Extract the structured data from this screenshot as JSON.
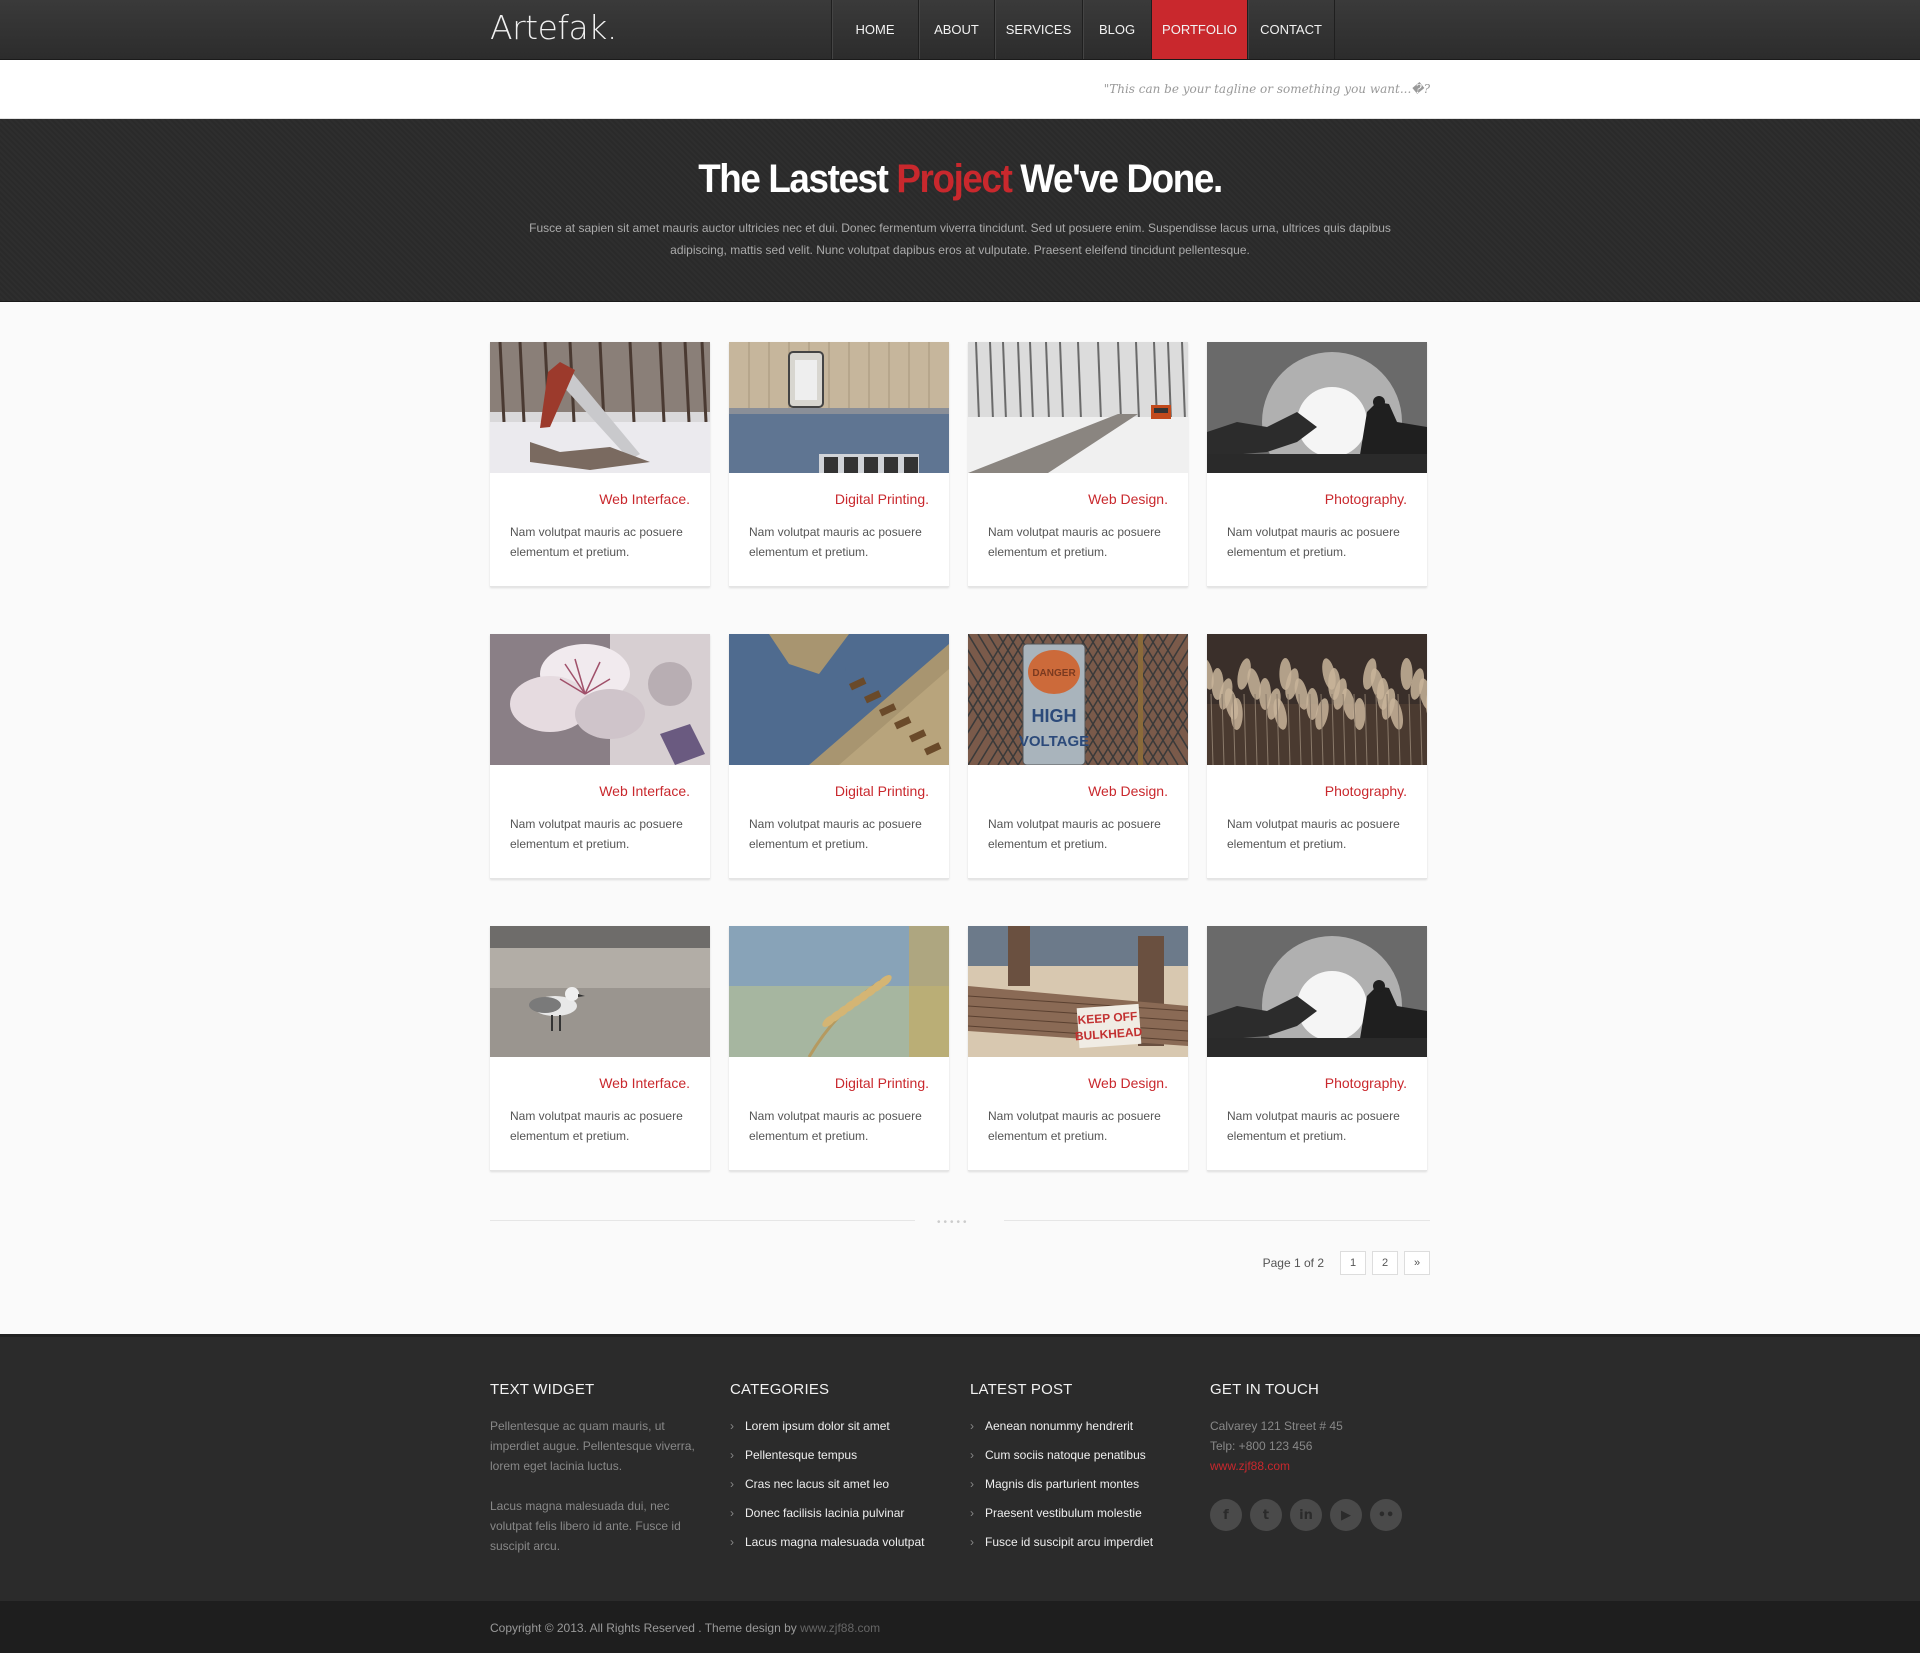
{
  "header": {
    "logo": "Artefak.",
    "nav": [
      "HOME",
      "ABOUT",
      "SERVICES",
      "BLOG",
      "PORTFOLIO",
      "CONTACT"
    ],
    "active_nav": "PORTFOLIO",
    "tagline": "\"This can be your tagline or something you want...�?"
  },
  "hero": {
    "title_pre": "The Lastest ",
    "title_accent": "Project",
    "title_post": " We've Done.",
    "subtitle": "Fusce at sapien sit amet mauris auctor ultricies nec et dui. Donec fermentum viverra tincidunt. Sed ut posuere enim. Suspendisse lacus urna, ultrices quis dapibus adipiscing, mattis sed velit. Nunc volutpat dapibus eros at vulputate. Praesent eleifend tincidunt pellentesque."
  },
  "portfolio": [
    {
      "category": "Web Interface.",
      "desc": "Nam volutpat mauris ac posuere elementum et pretium.",
      "image": "snowy-slide"
    },
    {
      "category": "Digital Printing.",
      "desc": "Nam volutpat mauris ac posuere elementum et pretium.",
      "image": "wall-lamp"
    },
    {
      "category": "Web Design.",
      "desc": "Nam volutpat mauris ac posuere elementum et pretium.",
      "image": "snowy-road"
    },
    {
      "category": "Photography.",
      "desc": "Nam volutpat mauris ac posuere elementum et pretium.",
      "image": "sunset-figure"
    },
    {
      "category": "Web Interface.",
      "desc": "Nam volutpat mauris ac posuere elementum et pretium.",
      "image": "blossom"
    },
    {
      "category": "Digital Printing.",
      "desc": "Nam volutpat mauris ac posuere elementum et pretium.",
      "image": "gear-board"
    },
    {
      "category": "Web Design.",
      "desc": "Nam volutpat mauris ac posuere elementum et pretium.",
      "image": "high-voltage-sign"
    },
    {
      "category": "Photography.",
      "desc": "Nam volutpat mauris ac posuere elementum et pretium.",
      "image": "reeds"
    },
    {
      "category": "Web Interface.",
      "desc": "Nam volutpat mauris ac posuere elementum et pretium.",
      "image": "seagull"
    },
    {
      "category": "Digital Printing.",
      "desc": "Nam volutpat mauris ac posuere elementum et pretium.",
      "image": "wheat"
    },
    {
      "category": "Web Design.",
      "desc": "Nam volutpat mauris ac posuere elementum et pretium.",
      "image": "keep-off-bulkhead"
    },
    {
      "category": "Photography.",
      "desc": "Nam volutpat mauris ac posuere elementum et pretium.",
      "image": "sunset-figure"
    }
  ],
  "image_text": {
    "high_voltage": [
      "DANGER",
      "HIGH",
      "VOLTAGE"
    ],
    "keep_off": [
      "KEEP OFF",
      "BULKHEAD"
    ]
  },
  "pager": {
    "info": "Page 1 of 2",
    "pages": [
      "1",
      "2"
    ],
    "next": "»",
    "current": "1"
  },
  "footer": {
    "text_widget": {
      "title": "TEXT WIDGET",
      "para1": "Pellentesque ac quam mauris, ut imperdiet augue. Pellentesque viverra, lorem eget lacinia luctus.",
      "para2": "Lacus magna malesuada dui, nec volutpat felis libero id ante. Fusce id suscipit arcu."
    },
    "categories": {
      "title": "CATEGORIES",
      "items": [
        "Lorem ipsum dolor sit amet",
        "Pellentesque tempus",
        "Cras nec lacus sit amet leo",
        "Donec facilisis lacinia pulvinar",
        "Lacus magna malesuada volutpat"
      ]
    },
    "latest_post": {
      "title": "LATEST POST",
      "items": [
        "Aenean nonummy hendrerit",
        "Cum sociis natoque penatibus",
        "Magnis dis parturient montes",
        "Praesent vestibulum molestie",
        "Fusce id suscipit arcu imperdiet"
      ]
    },
    "contact": {
      "title": "GET IN TOUCH",
      "address": "Calvarey 121 Street # 45",
      "phone": "Telp: +800 123 456",
      "website": "www.zjf88.com"
    },
    "socials": [
      {
        "name": "facebook-icon",
        "glyph": "f"
      },
      {
        "name": "twitter-icon",
        "glyph": "t"
      },
      {
        "name": "linkedin-icon",
        "glyph": "in"
      },
      {
        "name": "youtube-icon",
        "glyph": "▶"
      },
      {
        "name": "flickr-icon",
        "glyph": "••"
      }
    ]
  },
  "copyright": {
    "text": "Copyright © 2013. All Rights Reserved . Theme design by ",
    "site": "www.zjf88.com"
  },
  "colors": {
    "accent": "#c9282d",
    "dark": "#2b2b2b"
  }
}
